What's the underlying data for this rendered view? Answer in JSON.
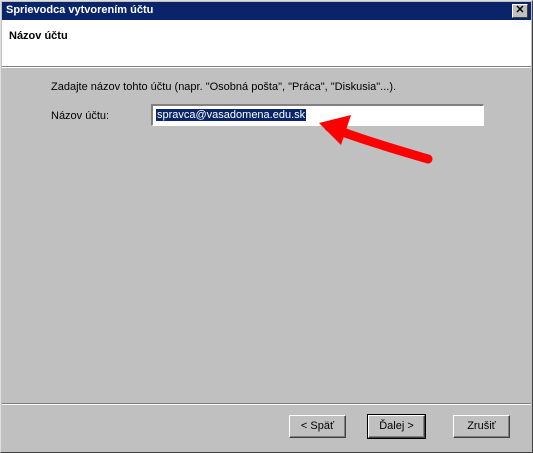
{
  "window": {
    "title": "Sprievodca vytvorením účtu",
    "close_glyph": "✕"
  },
  "header": {
    "title": "Názov účtu"
  },
  "content": {
    "instruction": "Zadajte názov tohto účtu (napr. \"Osobná pošta\", \"Práca\", \"Diskusia\"...).",
    "field_label": "Názov účtu:",
    "field_value": "spravca@vasadomena.edu.sk"
  },
  "buttons": {
    "back": "< Späť",
    "next": "Ďalej >",
    "cancel": "Zrušiť"
  },
  "annotation": {
    "arrow_color": "#ff0000"
  }
}
